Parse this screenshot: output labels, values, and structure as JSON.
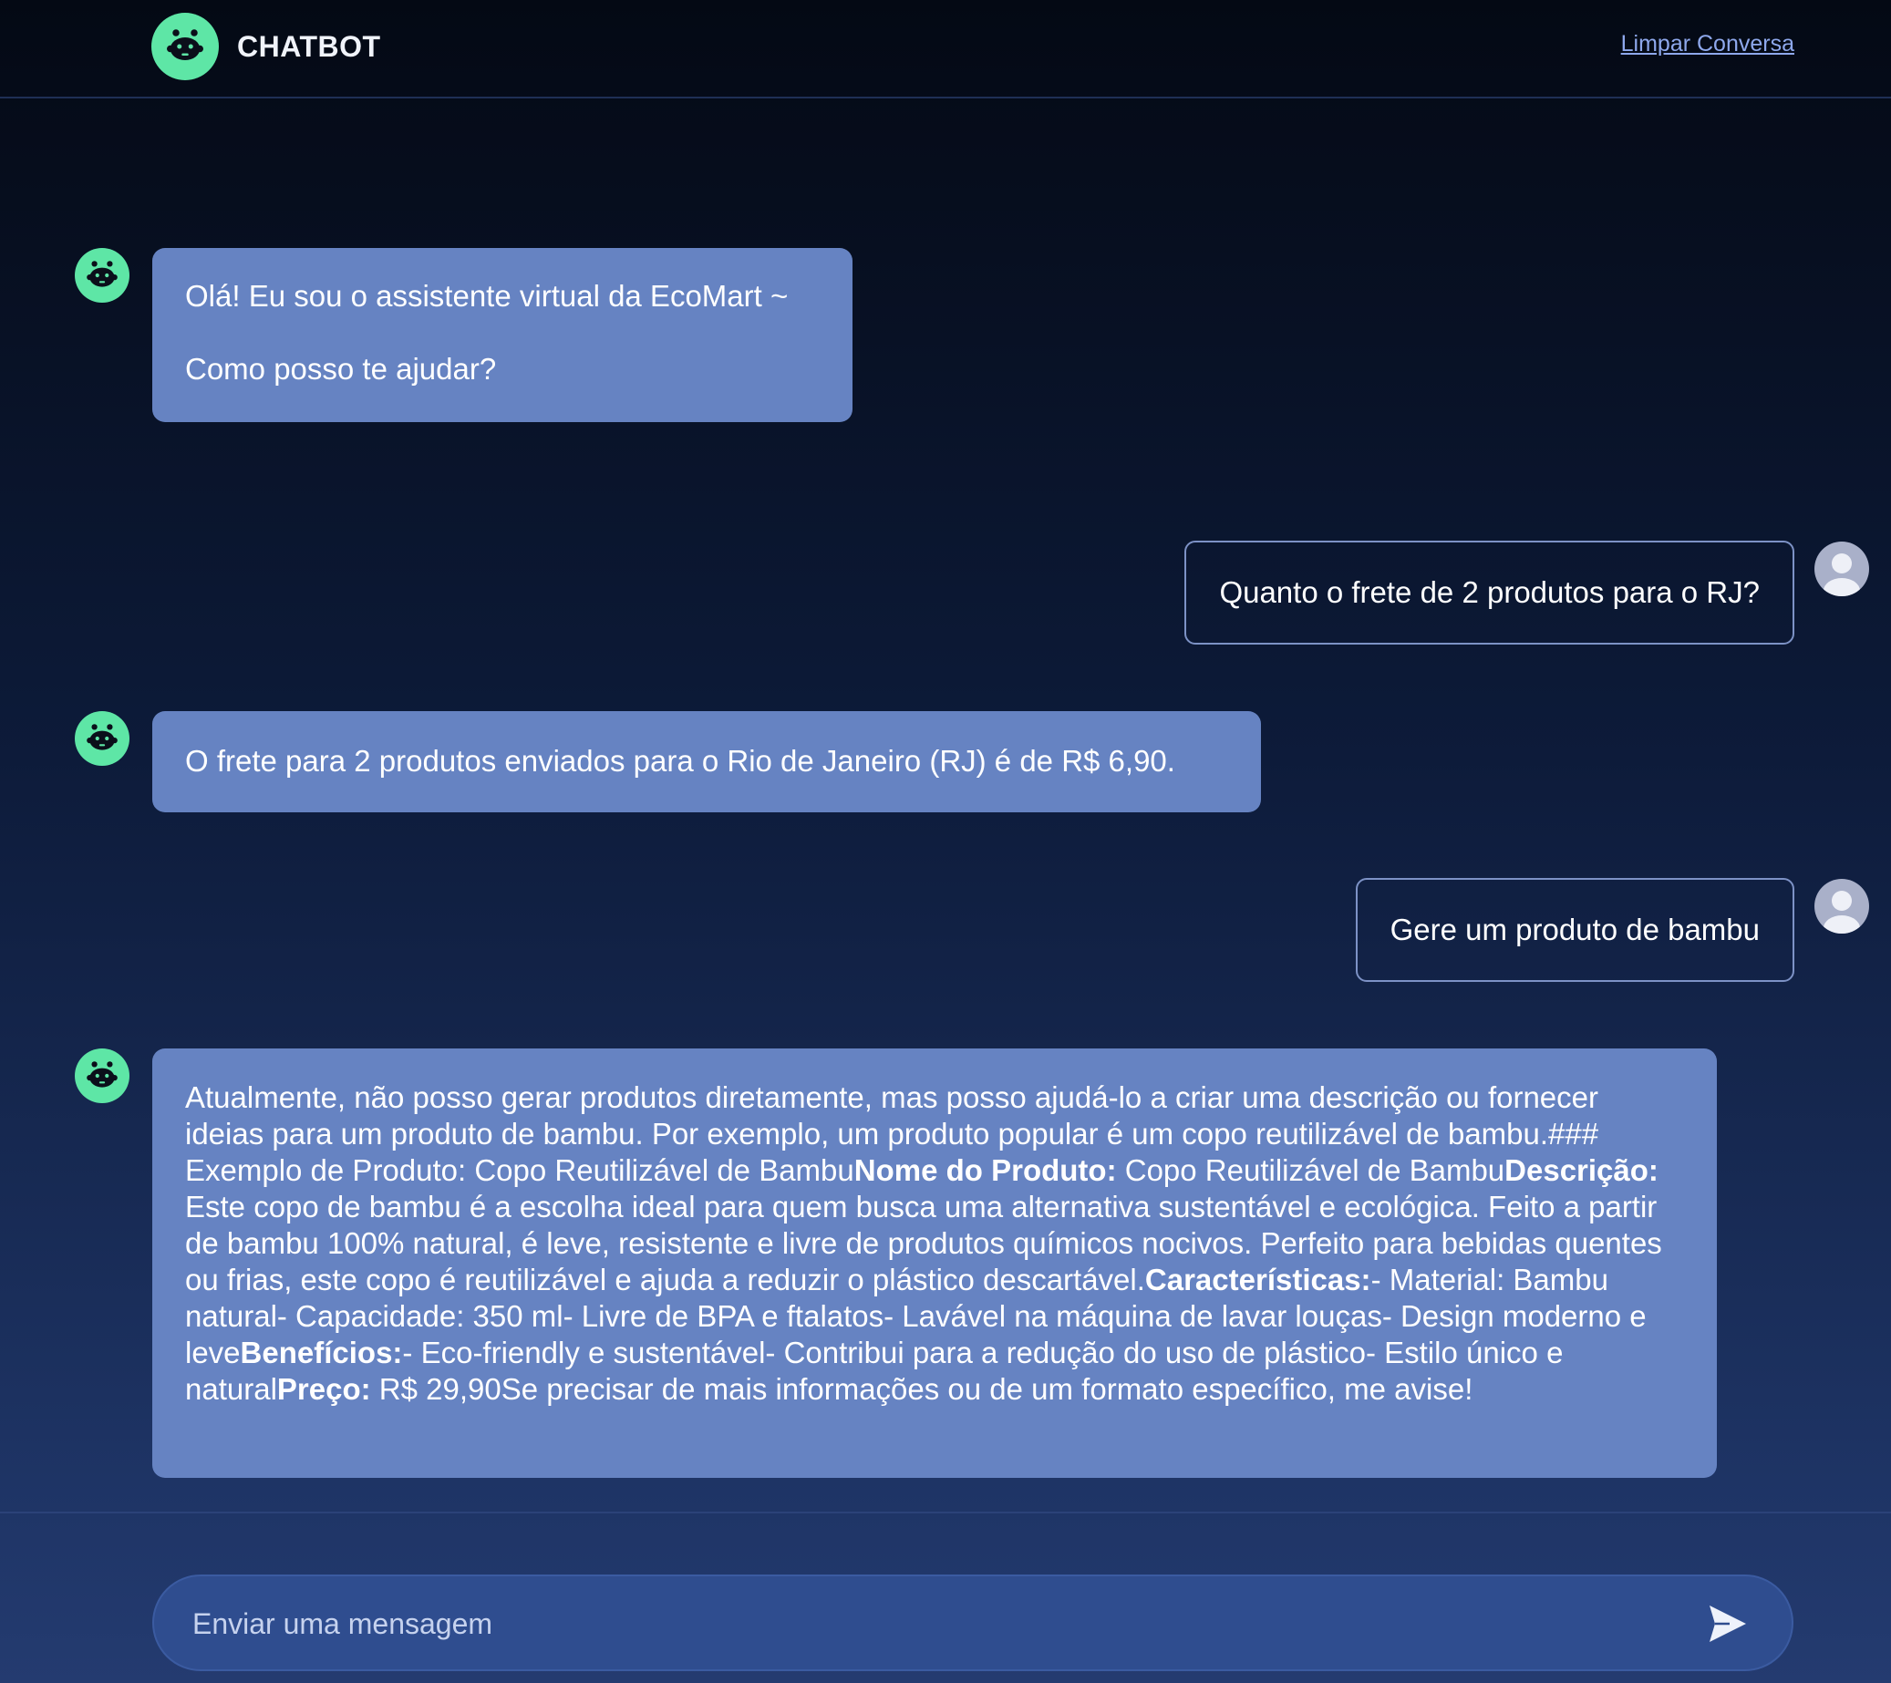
{
  "header": {
    "brand_name": "CHATBOT",
    "clear_label": "Limpar Conversa"
  },
  "messages": [
    {
      "role": "bot",
      "lines": [
        "Olá! Eu sou o assistente virtual da EcoMart ~",
        "Como posso te ajudar?"
      ]
    },
    {
      "role": "user",
      "text": "Quanto o frete de 2 produtos para o RJ?"
    },
    {
      "role": "bot",
      "text": "O frete para 2 produtos enviados para o Rio de Janeiro (RJ) é de R$ 6,90."
    },
    {
      "role": "user",
      "text": "Gere um produto de bambu"
    },
    {
      "role": "bot",
      "segments": [
        {
          "t": "Atualmente, não posso gerar produtos diretamente, mas posso ajudá-lo a criar uma descrição ou fornecer ideias para um produto de bambu. Por exemplo, um produto popular é um copo reutilizável de bambu.### Exemplo de Produto: Copo Reutilizável de Bambu"
        },
        {
          "t": "Nome do Produto:",
          "b": true
        },
        {
          "t": " Copo Reutilizável de Bambu"
        },
        {
          "t": "Descrição:",
          "b": true
        },
        {
          "t": " Este copo de bambu é a escolha ideal para quem busca uma alternativa sustentável e ecológica. Feito a partir de bambu 100% natural, é leve, resistente e livre de produtos químicos nocivos. Perfeito para bebidas quentes ou frias, este copo é reutilizável e ajuda a reduzir o plástico descartável."
        },
        {
          "t": "Características:",
          "b": true
        },
        {
          "t": "- Material: Bambu natural- Capacidade: 350 ml- Livre de BPA e ftalatos- Lavável na máquina de lavar louças- Design moderno e leve"
        },
        {
          "t": "Benefícios:",
          "b": true
        },
        {
          "t": "- Eco-friendly e sustentável- Contribui para a redução do uso de plástico- Estilo único e natural"
        },
        {
          "t": "Preço:",
          "b": true
        },
        {
          "t": " R$ 29,90Se precisar de mais informações ou de um formato específico, me avise!"
        }
      ]
    }
  ],
  "composer": {
    "placeholder": "Enviar uma mensagem"
  },
  "icons": {
    "brand": "robot-face-icon",
    "bot_avatar": "robot-face-icon",
    "user_avatar": "user-silhouette-icon",
    "send": "send-arrow-icon"
  },
  "colors": {
    "accent_green": "#5ee6a6",
    "bot_bubble": "#6683c2",
    "link": "#8ea8ec"
  }
}
